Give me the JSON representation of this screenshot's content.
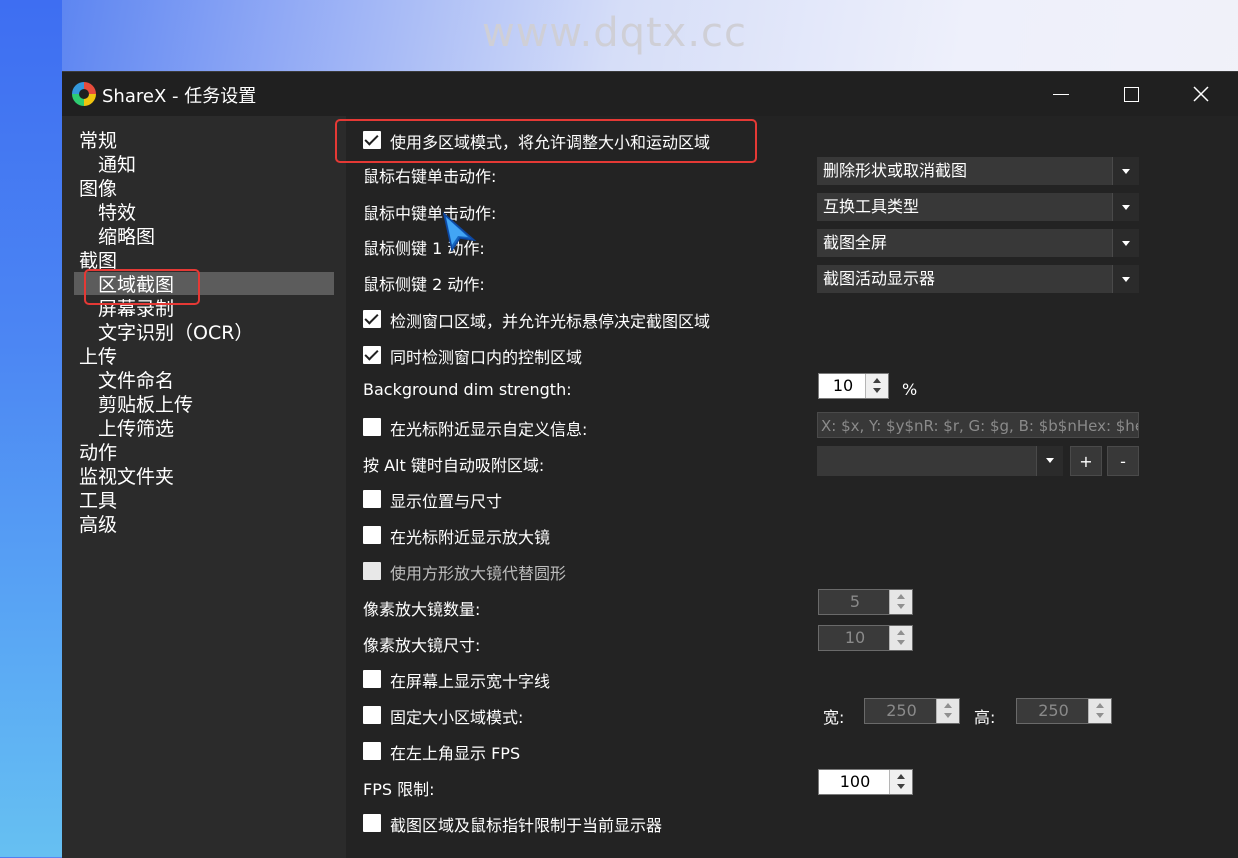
{
  "watermark": "www.dqtx.cc",
  "window": {
    "title": "ShareX - 任务设置",
    "controls": {
      "minimize": "minimize",
      "maximize": "maximize",
      "close": "close"
    }
  },
  "sidebar": {
    "items": [
      "常规",
      "通知",
      "图像",
      "特效",
      "缩略图",
      "截图",
      "区域截图",
      "屏幕录制",
      "文字识别（OCR）",
      "上传",
      "文件命名",
      "剪贴板上传",
      "上传筛选",
      "动作",
      "监视文件夹",
      "工具",
      "高级"
    ],
    "selected": "区域截图"
  },
  "settings": {
    "multi_region": "使用多区域模式，将允许调整大小和运动区域",
    "right_click_label": "鼠标右键单击动作:",
    "right_click_value": "删除形状或取消截图",
    "middle_click_label": "鼠标中键单击动作:",
    "middle_click_value": "互换工具类型",
    "side1_label": "鼠标侧键 1 动作:",
    "side1_value": "截图全屏",
    "side2_label": "鼠标侧键 2 动作:",
    "side2_value": "截图活动显示器",
    "detect_windows": "检测窗口区域，并允许光标悬停决定截图区域",
    "detect_controls": "同时检测窗口内的控制区域",
    "dim_label": "Background dim strength:",
    "dim_value": "10",
    "dim_unit": "%",
    "custom_info": "在光标附近显示自定义信息:",
    "custom_info_value": "X: $x, Y: $y$nR: $r, G: $g, B: $b$nHex: $hex",
    "alt_snap_label": "按 Alt 键时自动吸附区域:",
    "alt_add": "+",
    "alt_remove": "-",
    "show_pos_size": "显示位置与尺寸",
    "show_magnifier": "在光标附近显示放大镜",
    "square_magnifier": "使用方形放大镜代替圆形",
    "mag_count_label": "像素放大镜数量:",
    "mag_count_value": "5",
    "mag_size_label": "像素放大镜尺寸:",
    "mag_size_value": "10",
    "crosshair": "在屏幕上显示宽十字线",
    "fixed_size": "固定大小区域模式:",
    "width_label": "宽:",
    "width_value": "250",
    "height_label": "高:",
    "height_value": "250",
    "show_fps": "在左上角显示 FPS",
    "fps_limit_label": "FPS 限制:",
    "fps_limit_value": "100",
    "clip_monitor": "截图区域及鼠标指针限制于当前显示器"
  },
  "checkbox_states": {
    "multi_region": true,
    "detect_windows": true,
    "detect_controls": true,
    "custom_info": false,
    "show_pos_size": false,
    "show_magnifier": false,
    "square_magnifier": false,
    "crosshair": false,
    "fixed_size": false,
    "show_fps": false,
    "clip_monitor": false
  },
  "colors": {
    "highlight": "#e53935",
    "window_bg": "#2b2b2b",
    "content_bg": "#232323",
    "cursor": "#1e88e5"
  }
}
